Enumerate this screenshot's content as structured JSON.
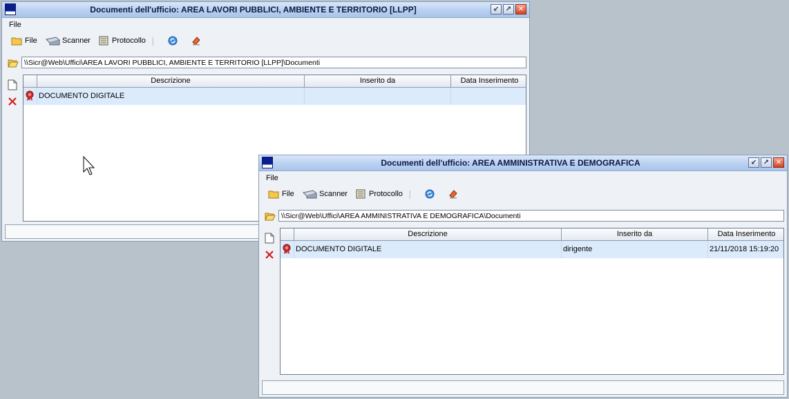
{
  "windows": [
    {
      "title": "Documenti dell'ufficio: AREA LAVORI PUBBLICI, AMBIENTE E TERRITORIO [LLPP]",
      "menu": [
        "File"
      ],
      "toolbar": {
        "file": "File",
        "scanner": "Scanner",
        "protocollo": "Protocollo"
      },
      "path": "\\\\Sicr@Web\\Uffici\\AREA LAVORI PUBBLICI, AMBIENTE E TERRITORIO [LLPP]\\Documenti",
      "columns": [
        "Descrizione",
        "Inserito da",
        "Data Inserimento"
      ],
      "rows": [
        {
          "descrizione": "DOCUMENTO DIGITALE",
          "inserito_da": "",
          "data_inserimento": ""
        }
      ],
      "status": ""
    },
    {
      "title": "Documenti dell'ufficio: AREA AMMINISTRATIVA E DEMOGRAFICA",
      "menu": [
        "File"
      ],
      "toolbar": {
        "file": "File",
        "scanner": "Scanner",
        "protocollo": "Protocollo"
      },
      "path": "\\\\Sicr@Web\\Uffici\\AREA AMMINISTRATIVA E DEMOGRAFICA\\Documenti",
      "columns": [
        "Descrizione",
        "Inserito da",
        "Data Inserimento"
      ],
      "rows": [
        {
          "descrizione": "DOCUMENTO DIGITALE",
          "inserito_da": "dirigente",
          "data_inserimento": "21/11/2018 15:19:20"
        }
      ],
      "status": ""
    }
  ],
  "colors": {
    "desktop": "#b8c2cb",
    "row_selected": "#dcebfb",
    "titlebar": "#bcd2f2"
  }
}
